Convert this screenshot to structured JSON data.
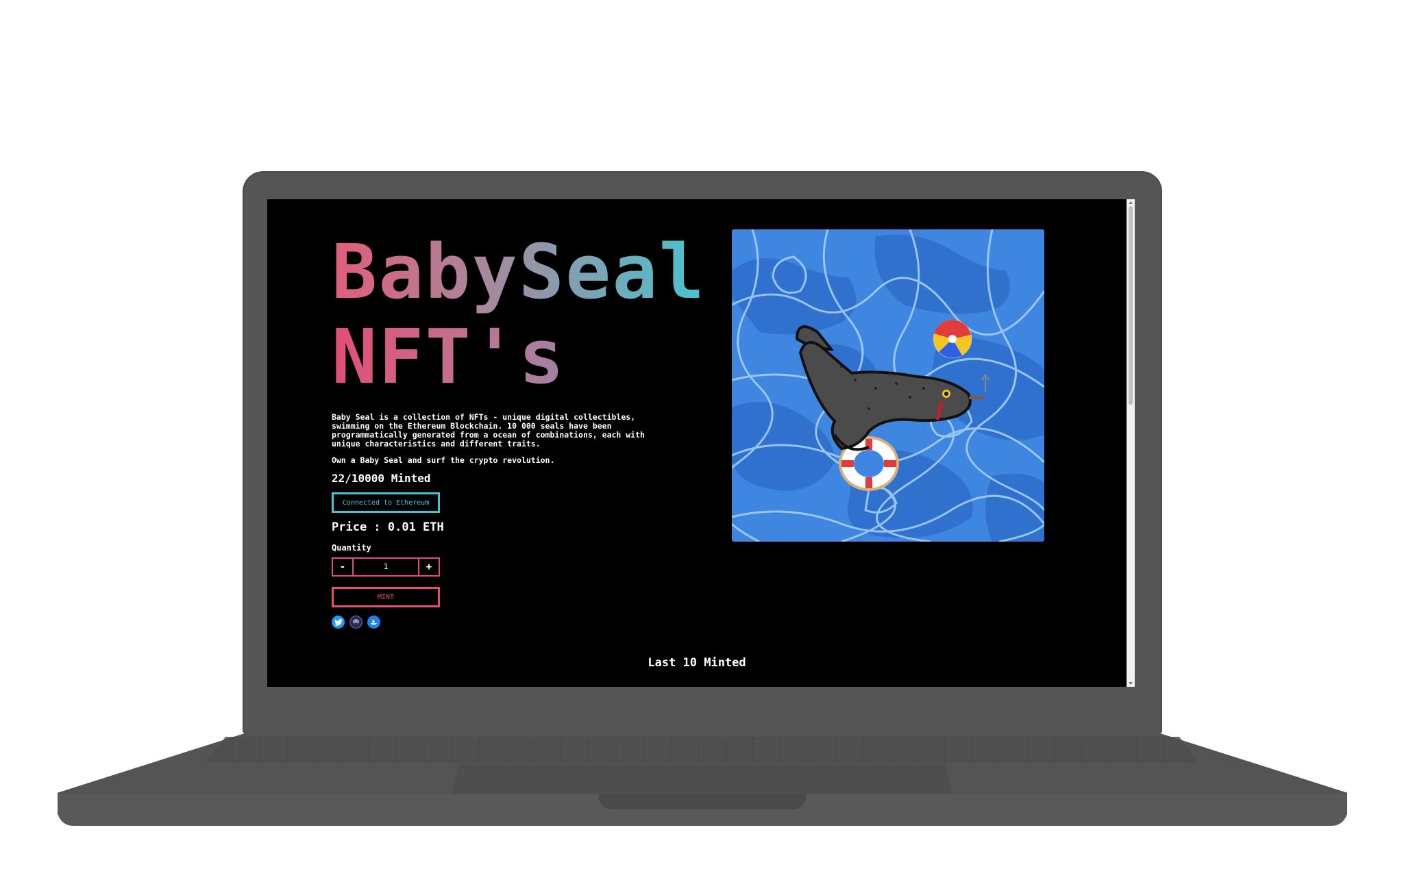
{
  "page": {
    "title_line1": "BabySeal",
    "title_line2": "NFT's",
    "description": "Baby Seal is a collection of NFTs - unique digital collectibles, swimming on the Ethereum Blockchain. 10 000 seals have been programmatically generated from a ocean of combinations, each with unique characteristics and different traits.",
    "tagline": "Own a Baby Seal and surf the crypto revolution.",
    "minted_count": "22/10000 Minted",
    "connect_label": "Connected to Ethereum",
    "price": "Price : 0.01 ETH",
    "quantity_label": "Quantity",
    "quantity_minus": "-",
    "quantity_value": "1",
    "quantity_plus": "+",
    "mint_label": "MINT",
    "last_minted_heading": "Last 10 Minted"
  },
  "socials": [
    {
      "icon": "twitter-icon"
    },
    {
      "icon": "discord-icon"
    },
    {
      "icon": "opensea-icon"
    }
  ],
  "colors": {
    "background": "#000000",
    "accent_pink": "#e24e74",
    "accent_cyan": "#49c3cf",
    "water_blue": "#3f86e0",
    "laptop_gray": "#555555"
  }
}
